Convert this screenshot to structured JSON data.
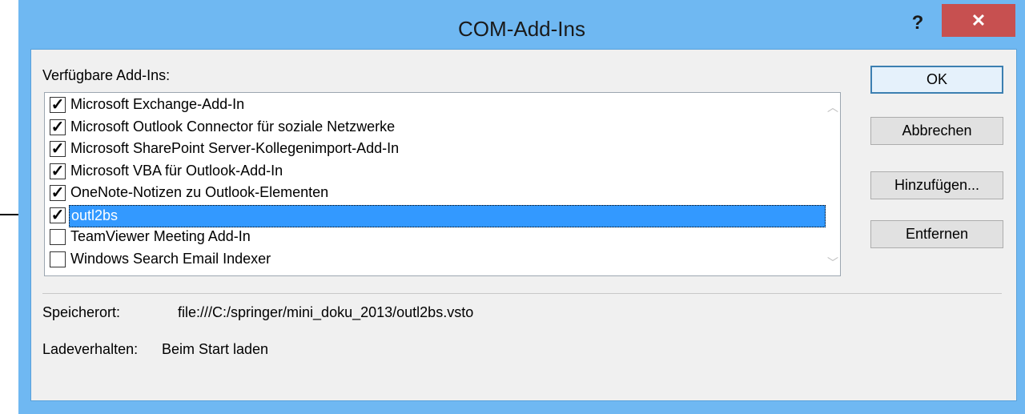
{
  "window": {
    "title": "COM-Add-Ins",
    "help_label": "?",
    "close_label": "✕"
  },
  "list": {
    "label": "Verfügbare Add-Ins:",
    "items": [
      {
        "label": "Microsoft Exchange-Add-In",
        "checked": true,
        "selected": false
      },
      {
        "label": "Microsoft Outlook Connector für soziale Netzwerke",
        "checked": true,
        "selected": false
      },
      {
        "label": "Microsoft SharePoint Server-Kollegenimport-Add-In",
        "checked": true,
        "selected": false
      },
      {
        "label": "Microsoft VBA für Outlook-Add-In",
        "checked": true,
        "selected": false
      },
      {
        "label": "OneNote-Notizen zu Outlook-Elementen",
        "checked": true,
        "selected": false
      },
      {
        "label": "outl2bs",
        "checked": true,
        "selected": true
      },
      {
        "label": "TeamViewer Meeting Add-In",
        "checked": false,
        "selected": false
      },
      {
        "label": "Windows Search Email Indexer",
        "checked": false,
        "selected": false
      }
    ]
  },
  "buttons": {
    "ok": "OK",
    "cancel": "Abbrechen",
    "add": "Hinzufügen...",
    "remove": "Entfernen"
  },
  "details": {
    "location_label": "Speicherort:",
    "location_value": "file:///C:/springer/mini_doku_2013/outl2bs.vsto",
    "load_label": "Ladeverhalten:",
    "load_value": "Beim Start laden"
  },
  "colors": {
    "title_bar": "#6fb8f2",
    "close_button": "#c75050",
    "selection": "#3399ff"
  }
}
